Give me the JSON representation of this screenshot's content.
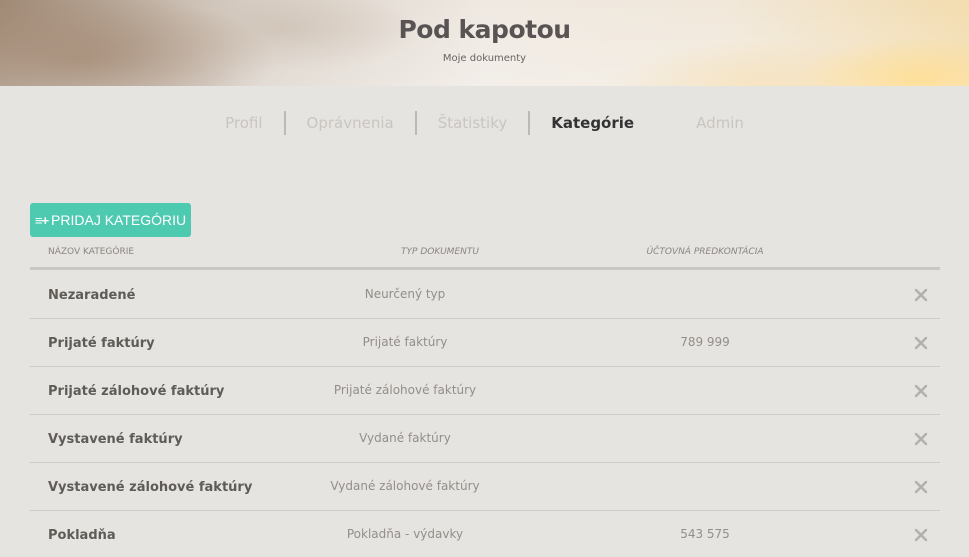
{
  "header": {
    "title": "Pod kapotou",
    "subtitle": "Moje dokumenty"
  },
  "tabs": [
    {
      "label": "Profil",
      "active": false
    },
    {
      "label": "Oprávnenia",
      "active": false
    },
    {
      "label": "Štatistiky",
      "active": false
    },
    {
      "label": "Kategórie",
      "active": true
    },
    {
      "label": "Admin",
      "active": false
    }
  ],
  "toolbar": {
    "add_icon": "list-plus-icon",
    "add_label": "PRIDAJ KATEGÓRIU"
  },
  "table": {
    "columns": {
      "name": "NÁZOV KATEGÓRIE",
      "type": "TYP DOKUMENTU",
      "account": "ÚČTOVNÁ PREDKONTÁCIA"
    },
    "rows": [
      {
        "name": "Nezaradené",
        "type": "Neurčený typ",
        "account": ""
      },
      {
        "name": "Prijaté faktúry",
        "type": "Prijaté faktúry",
        "account": "789 999"
      },
      {
        "name": "Prijaté zálohové faktúry",
        "type": "Prijaté zálohové faktúry",
        "account": ""
      },
      {
        "name": "Vystavené faktúry",
        "type": "Vydané faktúry",
        "account": ""
      },
      {
        "name": "Vystavené zálohové faktúry",
        "type": "Vydané zálohové faktúry",
        "account": ""
      },
      {
        "name": "Pokladňa",
        "type": "Pokladňa - výdavky",
        "account": "543 575"
      }
    ],
    "delete_icon": "close-icon"
  },
  "colors": {
    "accent": "#4ecab1",
    "background": "#e6e4e0"
  }
}
